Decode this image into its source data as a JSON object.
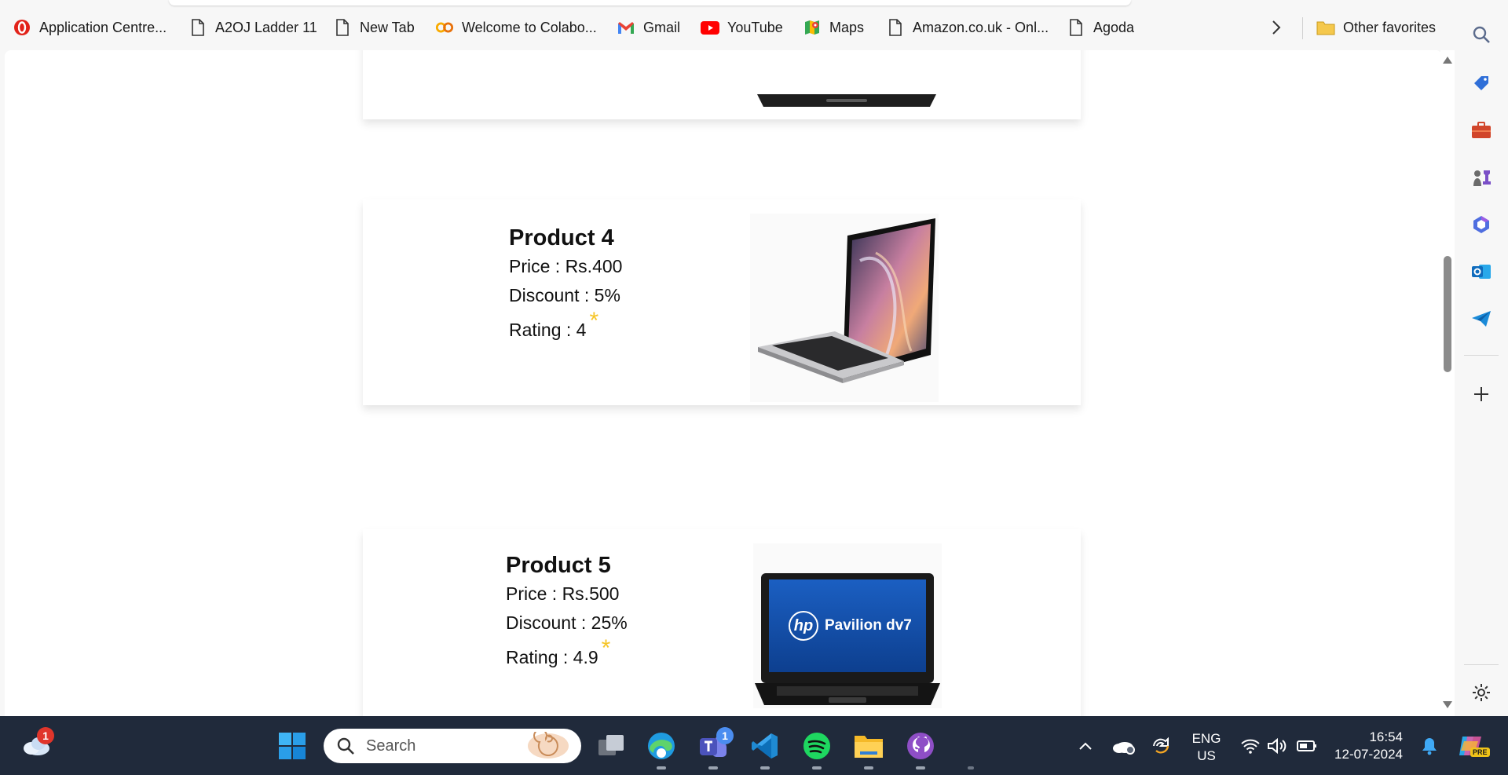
{
  "bookmarks": [
    {
      "label": "Application Centre...",
      "icon": "opera-icon"
    },
    {
      "label": "A2OJ Ladder 11",
      "icon": "page-icon"
    },
    {
      "label": "New Tab",
      "icon": "page-icon"
    },
    {
      "label": "Welcome to Colabo...",
      "icon": "colab-icon"
    },
    {
      "label": "Gmail",
      "icon": "gmail-icon"
    },
    {
      "label": "YouTube",
      "icon": "youtube-icon"
    },
    {
      "label": "Maps",
      "icon": "maps-icon"
    },
    {
      "label": "Amazon.co.uk - Onl...",
      "icon": "page-icon"
    },
    {
      "label": "Agoda",
      "icon": "page-icon"
    }
  ],
  "other_favorites": "Other favorites",
  "products": [
    {
      "title": "Product 4",
      "price": "Price : Rs.400",
      "discount": "Discount : 5%",
      "rating": "Rating : 4",
      "star": "*",
      "image": "laptop-image"
    },
    {
      "title": "Product 5",
      "price": "Price : Rs.500",
      "discount": "Discount : 25%",
      "rating": "Rating : 4.9",
      "star": "*",
      "image": "hp-laptop-image"
    }
  ],
  "hp_screen": {
    "brand": "hp",
    "model": "Pavilion dv7"
  },
  "taskbar": {
    "search_placeholder": "Search",
    "weather_badge": "1",
    "teams_badge": "1",
    "lang_top": "ENG",
    "lang_bottom": "US",
    "time": "16:54",
    "date": "12-07-2024",
    "copilot_badge": "PRE"
  },
  "colors": {
    "star": "#f6c528",
    "taskbar_bg": "#202a3b",
    "youtube_red": "#ff0000"
  }
}
